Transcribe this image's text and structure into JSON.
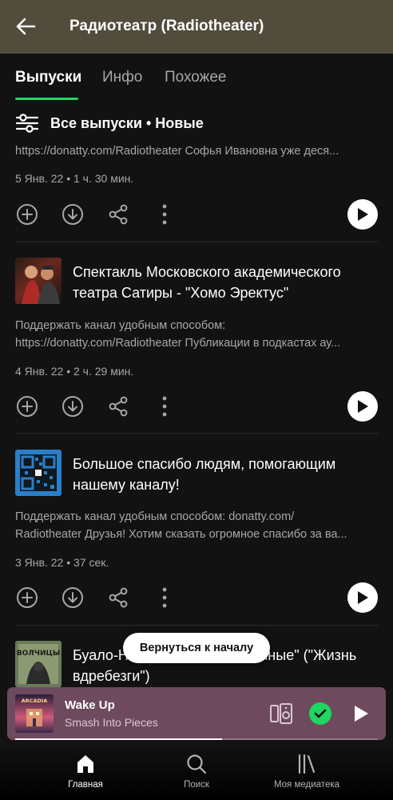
{
  "header": {
    "title": "Радиотеатр (Radiotheater)"
  },
  "tabs": [
    {
      "label": "Выпуски",
      "active": true
    },
    {
      "label": "Инфо",
      "active": false
    },
    {
      "label": "Похожее",
      "active": false
    }
  ],
  "filter": {
    "label": "Все выпуски • Новые"
  },
  "episodes": [
    {
      "title": "",
      "desc_lines": [
        "https://donatty.com/Radiotheater Софья Ивановна уже деся..."
      ],
      "meta": "5 Янв. 22 • 1 ч. 30 мин."
    },
    {
      "title": "Спектакль Московского академического театра Сатиры - \"Хомо Эректус\"",
      "desc_lines": [
        "Поддержать канал удобным способом:",
        "https://donatty.com/Radiotheater Публикации в подкастах ау..."
      ],
      "meta": "4 Янв. 22 • 2 ч. 29 мин."
    },
    {
      "title": "Большое спасибо людям, помогающим нашему каналу!",
      "desc_lines": [
        "Поддержать канал удобным способом: donatty.com/",
        "Radiotheater Друзья! Хотим сказать огромное спасибо за ва..."
      ],
      "meta": "3 Янв. 22 • 37 сек."
    },
    {
      "title": "Буало-Нарсежак - \"Прокаженные\" (\"Жизнь вдребезги\")",
      "desc_lines": [],
      "meta": ""
    }
  ],
  "toast": {
    "label": "Вернуться к началу"
  },
  "mini_player": {
    "title": "Wake Up",
    "artist": "Smash Into Pieces",
    "album_art_text": "ARCADIA",
    "progress": 0.57
  },
  "bottom_nav": [
    {
      "label": "Главная",
      "icon": "home-icon",
      "active": true
    },
    {
      "label": "Поиск",
      "icon": "search-icon",
      "active": false
    },
    {
      "label": "Моя медиатека",
      "icon": "library-icon",
      "active": false
    }
  ],
  "colors": {
    "header_bg": "#514c3c",
    "accent": "#1ed760",
    "mini_player_bg": "#6e4a5e",
    "background": "#121212"
  }
}
